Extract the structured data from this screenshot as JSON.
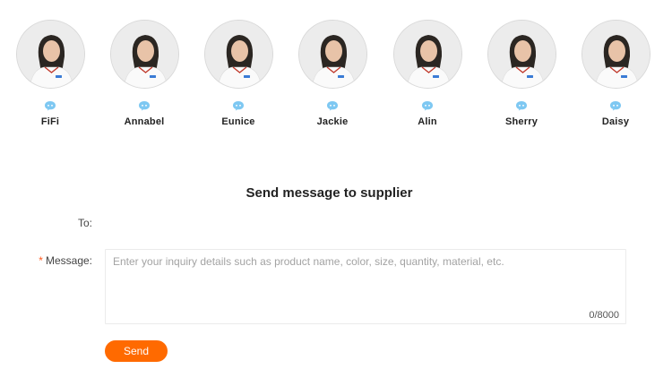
{
  "staff": [
    {
      "name": "FiFi",
      "chat_icon": "chat-bubble-icon"
    },
    {
      "name": "Annabel",
      "chat_icon": "chat-bubble-icon"
    },
    {
      "name": "Eunice",
      "chat_icon": "chat-bubble-icon"
    },
    {
      "name": "Jackie",
      "chat_icon": "chat-bubble-icon"
    },
    {
      "name": "Alin",
      "chat_icon": "chat-bubble-icon"
    },
    {
      "name": "Sherry",
      "chat_icon": "chat-bubble-icon"
    },
    {
      "name": "Daisy",
      "chat_icon": "chat-bubble-icon"
    }
  ],
  "form": {
    "title": "Send message to supplier",
    "to_label": "To:",
    "to_value": "",
    "required_marker": "*",
    "message_label": "Message:",
    "message_placeholder": "Enter your inquiry details such as product name, color, size, quantity, material, etc.",
    "message_value": "",
    "counter": "0/8000",
    "send_label": "Send"
  },
  "colors": {
    "accent": "#ff6a00",
    "required": "#ff5a1f",
    "chat_icon": "#7ec8f2"
  }
}
